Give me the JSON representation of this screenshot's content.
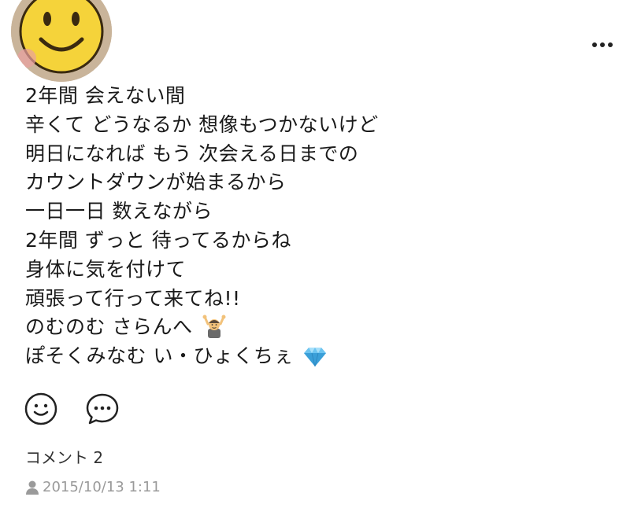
{
  "post": {
    "lines": [
      "2年間 会えない間",
      "辛くて どうなるか 想像もつかないけど",
      "明日になれば もう 次会える日までの",
      "カウントダウンが始まるから",
      "一日一日 数えながら",
      "2年間 ずっと 待ってるからね",
      "身体に気を付けて",
      "頑張って行って来てね!!",
      "のむのむ さらんへ",
      "ぽそくみなむ い・ひょくちぇ"
    ],
    "emojis": {
      "line_9": "person-gesturing-ok-emoji",
      "line_10": "gem-emoji"
    }
  },
  "author": {
    "avatar_icon": "smiley-face-icon"
  },
  "actions": {
    "react_icon": "smile-icon",
    "comment_icon": "speech-bubble-icon",
    "more_icon": "more-dots-icon"
  },
  "comments": {
    "label": "コメント 2"
  },
  "meta": {
    "timestamp": "2015/10/13 1:11",
    "icon": "person-icon"
  },
  "colors": {
    "text": "#1a1a1a",
    "meta": "#9a9a9a",
    "smiley": "#f5d33a",
    "gem": "#6cc4f0"
  }
}
